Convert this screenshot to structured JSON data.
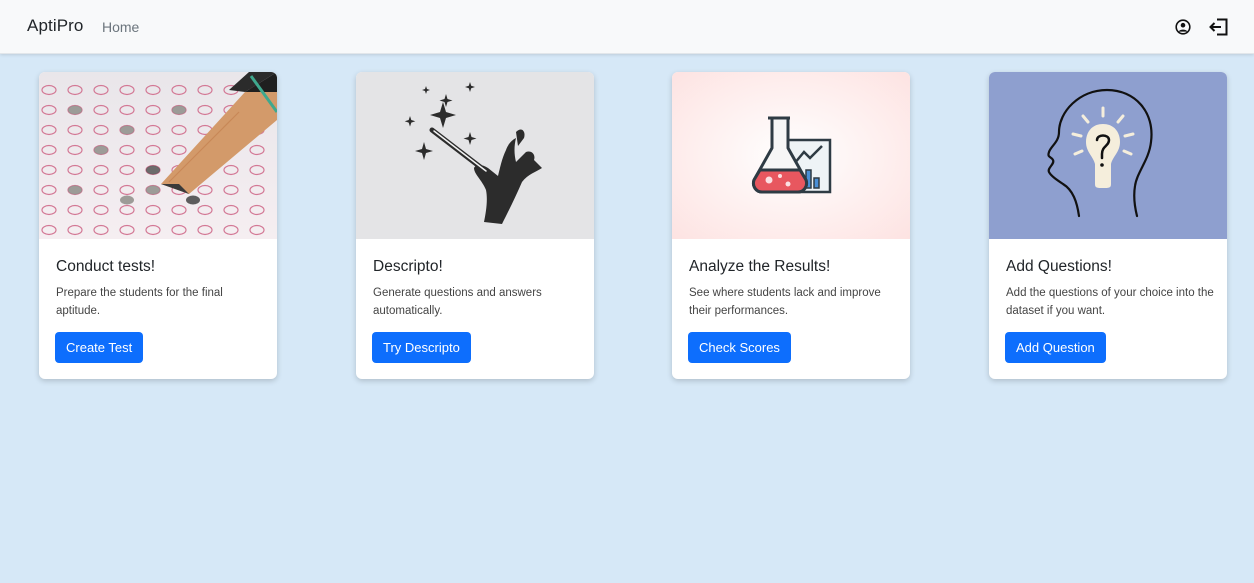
{
  "navbar": {
    "brand": "AptiPro",
    "home_link": "Home",
    "user_icon": "user-circle-icon",
    "logout_icon": "logout-icon"
  },
  "colors": {
    "page_background": "#d6e8f7",
    "navbar_background": "#f8f9fa",
    "primary_button": "#0d6efd"
  },
  "cards": [
    {
      "title": "Conduct tests!",
      "text": "Prepare the students for the final aptitude.",
      "button": "Create Test",
      "image": "pencil-answer-sheet-image"
    },
    {
      "title": "Descripto!",
      "text": "Generate questions and answers automatically.",
      "button": "Try Descripto",
      "image": "magic-wand-hand-image"
    },
    {
      "title": "Analyze the Results!",
      "text": "See where students lack and improve their performances.",
      "button": "Check Scores",
      "image": "flask-chart-image"
    },
    {
      "title": "Add Questions!",
      "text": "Add the questions of your choice into the dataset if you want.",
      "button": "Add Question",
      "image": "head-lightbulb-question-image"
    }
  ]
}
